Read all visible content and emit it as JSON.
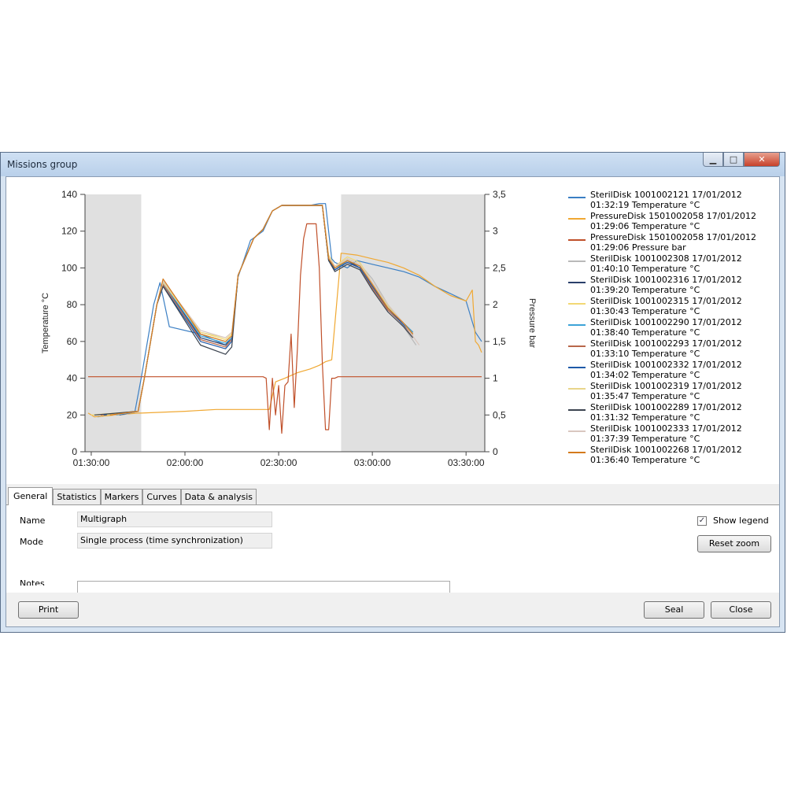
{
  "window": {
    "title": "Missions group"
  },
  "title_buttons": {
    "minimize": "▁",
    "maximize": "□",
    "close": "✕"
  },
  "tabs": [
    "General",
    "Statistics",
    "Markers",
    "Curves",
    "Data & analysis"
  ],
  "general": {
    "name_label": "Name",
    "name_value": "Multigraph",
    "mode_label": "Mode",
    "mode_value": "Single process (time synchronization)",
    "notes_label": "Notes",
    "show_legend_label": "Show legend",
    "show_legend_checked": true,
    "reset_zoom_label": "Reset zoom"
  },
  "buttons": {
    "print": "Print",
    "seal": "Seal",
    "close": "Close"
  },
  "chart_data": {
    "type": "line",
    "xlabel": "",
    "ylabel": "Temperature °C",
    "y2label": "Pressure bar",
    "x_ticks": [
      "01:30:00",
      "02:00:00",
      "02:30:00",
      "03:00:00",
      "03:30:00"
    ],
    "xlim": [
      "01:28:00",
      "03:36:00"
    ],
    "ylim": [
      0,
      140
    ],
    "y_ticks": [
      0,
      20,
      40,
      60,
      80,
      100,
      120,
      140
    ],
    "y2lim": [
      0,
      3.5
    ],
    "y2_ticks": [
      "0",
      "0,5",
      "1",
      "1,5",
      "2",
      "2,5",
      "3",
      "3,5"
    ],
    "shaded_regions": [
      [
        "01:28:00",
        "01:46:00"
      ],
      [
        "02:50:00",
        "03:36:00"
      ]
    ],
    "grid": false,
    "legend_position": "right",
    "series": [
      {
        "name": "SterilDisk 1001002121 17/01/2012 01:32:19 Temperature °C",
        "color": "#3b7fc4",
        "axis": "left",
        "x": [
          "01:32",
          "01:44",
          "01:46",
          "01:50",
          "01:52",
          "01:55",
          "02:05",
          "02:13",
          "02:15",
          "02:17",
          "02:21",
          "02:25",
          "02:28",
          "02:31",
          "02:34",
          "02:36",
          "02:38",
          "02:40",
          "02:43",
          "02:45",
          "02:47",
          "02:48",
          "02:52",
          "02:55",
          "03:00",
          "03:05",
          "03:10",
          "03:15",
          "03:20",
          "03:25",
          "03:30",
          "03:33",
          "03:35"
        ],
        "y": [
          19,
          22,
          40,
          80,
          92,
          68,
          64,
          58,
          62,
          95,
          115,
          120,
          131,
          134,
          134,
          134,
          134,
          134,
          135,
          135,
          105,
          103,
          100,
          104,
          102,
          100,
          98,
          95,
          90,
          86,
          82,
          65,
          60
        ]
      },
      {
        "name": "PressureDisk 1501002058 17/01/2012 01:29:06 Temperature °C",
        "color": "#f0a832",
        "axis": "left",
        "x": [
          "01:29",
          "01:31",
          "01:45",
          "01:46",
          "02:00",
          "02:10",
          "02:15",
          "02:17",
          "02:20",
          "02:23",
          "02:27",
          "02:29",
          "02:32",
          "02:36",
          "02:40",
          "02:43",
          "02:45",
          "02:47",
          "02:50",
          "02:55",
          "03:00",
          "03:05",
          "03:10",
          "03:15",
          "03:20",
          "03:25",
          "03:30",
          "03:32",
          "03:33",
          "03:34",
          "03:35"
        ],
        "y": [
          21,
          19,
          21,
          21,
          22,
          23,
          23,
          23,
          23,
          23,
          23,
          38,
          40,
          43,
          45,
          47,
          49,
          50,
          108,
          107,
          105,
          103,
          100,
          96,
          90,
          85,
          82,
          88,
          60,
          58,
          54
        ]
      },
      {
        "name": "PressureDisk 1501002058 17/01/2012 01:29:06 Pressure bar",
        "color": "#c0502a",
        "axis": "right",
        "x": [
          "01:29",
          "02:25",
          "02:26",
          "02:27",
          "02:28",
          "02:29",
          "02:30",
          "02:31",
          "02:32",
          "02:33",
          "02:34",
          "02:35",
          "02:36",
          "02:37",
          "02:38",
          "02:39",
          "02:40",
          "02:41",
          "02:42",
          "02:43",
          "02:44",
          "02:45",
          "02:46",
          "02:47",
          "02:48",
          "02:49",
          "02:50",
          "03:00",
          "03:20",
          "03:35"
        ],
        "y": [
          1.02,
          1.02,
          1.0,
          0.3,
          1.0,
          0.5,
          0.9,
          0.25,
          0.9,
          0.95,
          1.6,
          0.6,
          1.4,
          2.4,
          2.9,
          3.1,
          3.1,
          3.1,
          3.1,
          2.5,
          1.2,
          0.3,
          0.3,
          1.0,
          1.0,
          1.02,
          1.02,
          1.02,
          1.02,
          1.02
        ]
      },
      {
        "name": "SterilDisk 1001002308 17/01/2012 01:40:10 Temperature °C",
        "color": "#b9b9b9",
        "axis": "left",
        "x": [
          "01:40",
          "01:45",
          "01:47",
          "01:51",
          "01:53",
          "02:05",
          "02:13",
          "02:15",
          "02:17",
          "02:22",
          "02:25",
          "02:28",
          "02:31",
          "02:40",
          "02:44",
          "02:46",
          "02:48",
          "02:52",
          "02:56",
          "03:00",
          "03:05",
          "03:10",
          "03:14"
        ],
        "y": [
          20,
          22,
          40,
          80,
          90,
          64,
          60,
          63,
          96,
          116,
          121,
          131,
          134,
          134,
          134,
          106,
          100,
          105,
          102,
          94,
          80,
          68,
          58
        ]
      },
      {
        "name": "SterilDisk 1001002316 17/01/2012 01:39:20 Temperature °C",
        "color": "#2a3f6a",
        "axis": "left",
        "x": [
          "01:39",
          "01:45",
          "01:47",
          "01:51",
          "01:53",
          "02:05",
          "02:13",
          "02:15",
          "02:17",
          "02:22",
          "02:25",
          "02:28",
          "02:31",
          "02:40",
          "02:44",
          "02:46",
          "02:48",
          "02:52",
          "02:56",
          "03:00",
          "03:05",
          "03:10",
          "03:13"
        ],
        "y": [
          20,
          22,
          40,
          80,
          92,
          62,
          58,
          62,
          96,
          116,
          121,
          131,
          134,
          134,
          134,
          105,
          99,
          104,
          100,
          90,
          78,
          70,
          65
        ]
      },
      {
        "name": "SterilDisk 1001002315 17/01/2012 01:30:43 Temperature °C",
        "color": "#f2d874",
        "axis": "left",
        "x": [
          "01:30",
          "01:45",
          "01:47",
          "01:51",
          "01:53",
          "02:05",
          "02:13",
          "02:15",
          "02:17",
          "02:22",
          "02:25",
          "02:28",
          "02:31",
          "02:40",
          "02:44",
          "02:46",
          "02:48",
          "02:52",
          "02:56",
          "03:00",
          "03:05",
          "03:10",
          "03:13"
        ],
        "y": [
          20,
          22,
          40,
          80,
          93,
          65,
          61,
          64,
          96,
          116,
          121,
          131,
          134,
          134,
          134,
          107,
          101,
          106,
          103,
          92,
          80,
          70,
          64
        ]
      },
      {
        "name": "SterilDisk 1001002290 17/01/2012 01:38:40 Temperature °C",
        "color": "#3da3d8",
        "axis": "left",
        "x": [
          "01:38",
          "01:45",
          "01:47",
          "01:51",
          "01:53",
          "02:05",
          "02:13",
          "02:15",
          "02:17",
          "02:22",
          "02:25",
          "02:28",
          "02:31",
          "02:40",
          "02:44",
          "02:46",
          "02:48",
          "02:52",
          "02:56",
          "03:00",
          "03:05",
          "03:10",
          "03:13"
        ],
        "y": [
          20,
          22,
          40,
          80,
          92,
          63,
          59,
          62,
          96,
          116,
          121,
          131,
          134,
          134,
          134,
          104,
          99,
          104,
          101,
          91,
          79,
          70,
          65
        ]
      },
      {
        "name": "SterilDisk 1001002293 17/01/2012 01:33:10 Temperature °C",
        "color": "#b8674a",
        "axis": "left",
        "x": [
          "01:33",
          "01:45",
          "01:47",
          "01:51",
          "01:53",
          "02:05",
          "02:13",
          "02:15",
          "02:17",
          "02:22",
          "02:25",
          "02:28",
          "02:31",
          "02:40",
          "02:44",
          "02:46",
          "02:48",
          "02:52",
          "02:56",
          "03:00",
          "03:05",
          "03:10",
          "03:13"
        ],
        "y": [
          20,
          22,
          40,
          80,
          91,
          61,
          57,
          61,
          96,
          116,
          121,
          131,
          134,
          134,
          134,
          104,
          99,
          103,
          100,
          89,
          77,
          69,
          63
        ]
      },
      {
        "name": "SterilDisk 1001002332 17/01/2012 01:34:02 Temperature °C",
        "color": "#1e5aa8",
        "axis": "left",
        "x": [
          "01:34",
          "01:45",
          "01:47",
          "01:51",
          "01:53",
          "02:05",
          "02:13",
          "02:15",
          "02:17",
          "02:22",
          "02:25",
          "02:28",
          "02:31",
          "02:40",
          "02:44",
          "02:46",
          "02:48",
          "02:52",
          "02:56",
          "03:00",
          "03:05",
          "03:10",
          "03:13"
        ],
        "y": [
          20,
          22,
          40,
          80,
          90,
          60,
          56,
          60,
          96,
          116,
          121,
          131,
          134,
          134,
          134,
          104,
          99,
          103,
          100,
          90,
          78,
          69,
          64
        ]
      },
      {
        "name": "SterilDisk 1001002319 17/01/2012 01:35:47 Temperature °C",
        "color": "#e9d58a",
        "axis": "left",
        "x": [
          "01:35",
          "01:45",
          "01:47",
          "01:51",
          "01:53",
          "02:05",
          "02:13",
          "02:15",
          "02:17",
          "02:22",
          "02:25",
          "02:28",
          "02:31",
          "02:40",
          "02:44",
          "02:46",
          "02:48",
          "02:52",
          "02:56",
          "03:00",
          "03:05",
          "03:10",
          "03:13"
        ],
        "y": [
          20,
          22,
          40,
          80,
          92,
          65,
          62,
          65,
          96,
          116,
          121,
          131,
          134,
          134,
          134,
          106,
          100,
          105,
          102,
          91,
          79,
          70,
          64
        ]
      },
      {
        "name": "SterilDisk 1001002289 17/01/2012 01:31:32 Temperature °C",
        "color": "#3c4450",
        "axis": "left",
        "x": [
          "01:31",
          "01:45",
          "01:47",
          "01:51",
          "01:53",
          "02:05",
          "02:13",
          "02:15",
          "02:17",
          "02:22",
          "02:25",
          "02:28",
          "02:31",
          "02:40",
          "02:44",
          "02:46",
          "02:48",
          "02:52",
          "02:56",
          "03:00",
          "03:05",
          "03:10",
          "03:13"
        ],
        "y": [
          20,
          22,
          40,
          80,
          90,
          58,
          53,
          57,
          96,
          116,
          121,
          131,
          134,
          134,
          134,
          104,
          98,
          102,
          99,
          88,
          76,
          68,
          62
        ]
      },
      {
        "name": "SterilDisk 1001002333 17/01/2012 01:37:39 Temperature °C",
        "color": "#d9c7c0",
        "axis": "left",
        "x": [
          "01:37",
          "01:45",
          "01:47",
          "01:51",
          "01:53",
          "02:05",
          "02:13",
          "02:15",
          "02:17",
          "02:22",
          "02:25",
          "02:28",
          "02:31",
          "02:40",
          "02:44",
          "02:46",
          "02:48",
          "02:52",
          "02:56",
          "03:00",
          "03:05",
          "03:10",
          "03:15"
        ],
        "y": [
          20,
          22,
          40,
          80,
          93,
          66,
          62,
          65,
          96,
          116,
          121,
          131,
          134,
          134,
          134,
          106,
          101,
          105,
          102,
          92,
          80,
          70,
          58
        ]
      },
      {
        "name": "SterilDisk 1001002268 17/01/2012 01:36:40 Temperature °C",
        "color": "#d47a1c",
        "axis": "left",
        "x": [
          "01:36",
          "01:45",
          "01:47",
          "01:51",
          "01:53",
          "02:05",
          "02:13",
          "02:15",
          "02:17",
          "02:22",
          "02:25",
          "02:28",
          "02:31",
          "02:40",
          "02:44",
          "02:46",
          "02:48",
          "02:52",
          "02:56",
          "03:00",
          "03:05",
          "03:10",
          "03:13"
        ],
        "y": [
          20,
          22,
          40,
          80,
          94,
          64,
          60,
          63,
          96,
          116,
          121,
          131,
          134,
          134,
          134,
          105,
          100,
          104,
          101,
          91,
          78,
          70,
          64
        ]
      }
    ]
  }
}
